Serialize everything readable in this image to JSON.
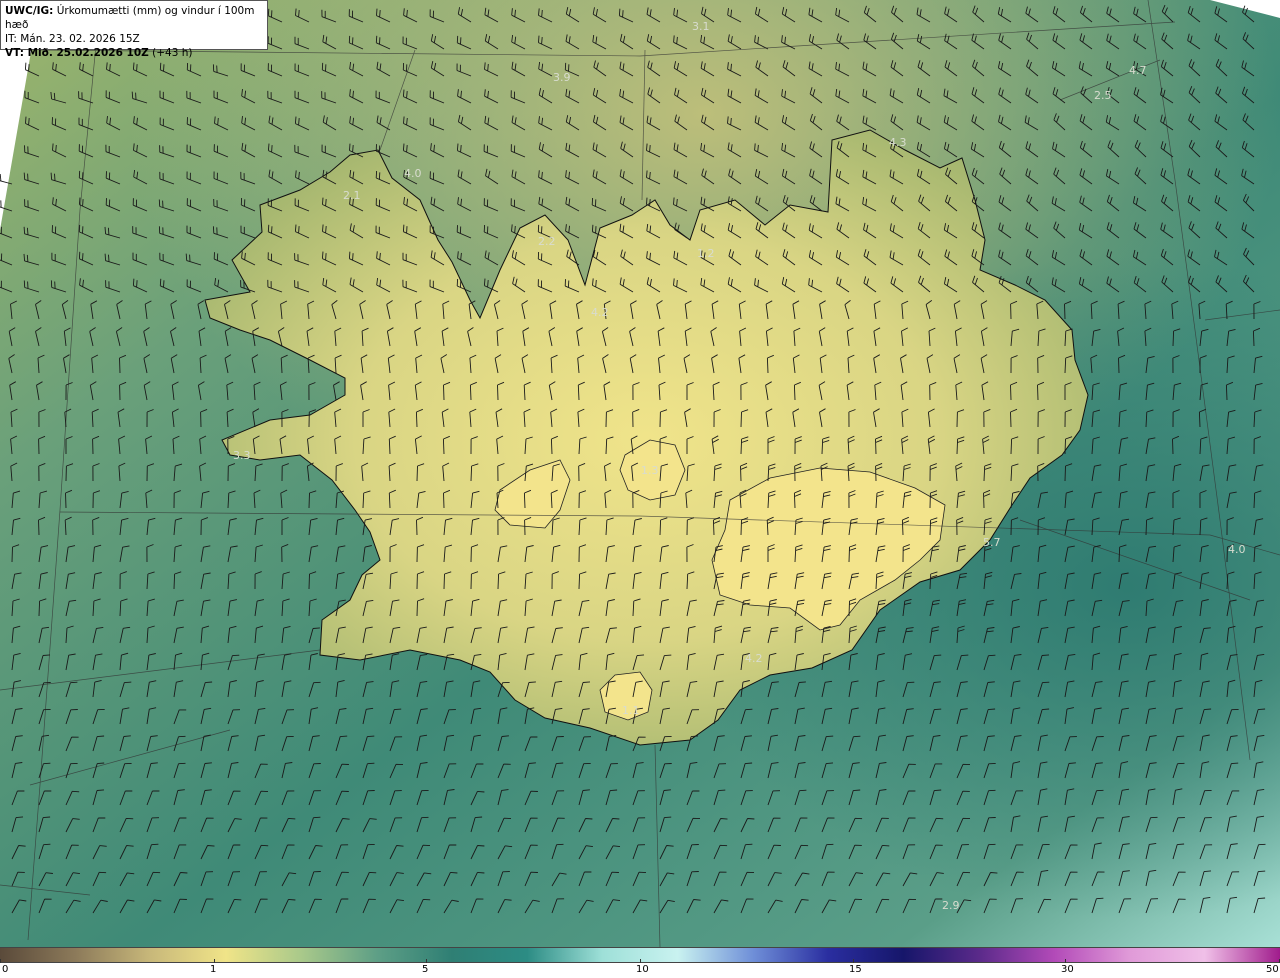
{
  "header": {
    "model": "UWC/IG:",
    "description": "Úrkomumætti (mm) og vindur í 100m hæð",
    "issue_time": "IT: Mán. 23. 02. 2026 15Z",
    "valid_prefix": "VT: Mið. 25.02.2026 10Z",
    "valid_lead": "(+43 h)"
  },
  "colorbar": {
    "ticks": [
      "0",
      "1",
      "5",
      "10",
      "15",
      "30",
      "50"
    ],
    "tick_positions": [
      0.0,
      0.167,
      0.333,
      0.5,
      0.667,
      0.833,
      1.0
    ],
    "colors": [
      "#5a4a3a",
      "#8c7a5a",
      "#c8b87a",
      "#f0e488",
      "#a9c98a",
      "#5e9f86",
      "#2f7f74",
      "#2c8c84",
      "#9ee0d8",
      "#c9f2f0",
      "#6f8fd8",
      "#2a2ea0",
      "#16166a",
      "#5a2a8a",
      "#b24ab8",
      "#e09ad8",
      "#f0c0e8",
      "#a01c8c"
    ]
  },
  "map_labels": [
    {
      "text": "3.1"
    },
    {
      "text": "3.9"
    },
    {
      "text": "4.7"
    },
    {
      "text": "2.5"
    },
    {
      "text": "4.3"
    },
    {
      "text": "4.0"
    },
    {
      "text": "2.1"
    },
    {
      "text": "2.2"
    },
    {
      "text": "4.2"
    },
    {
      "text": "1.2"
    },
    {
      "text": "3.3"
    },
    {
      "text": "1.3"
    },
    {
      "text": "5.7"
    },
    {
      "text": "4.0"
    },
    {
      "text": "4.2"
    },
    {
      "text": "1.1"
    },
    {
      "text": "2.9"
    }
  ],
  "palette": {
    "sea_deep": "#2f7d6e",
    "sea_mid": "#4e9383",
    "land_yellow": "#e7df8b",
    "land_olive": "#a9b36b",
    "coast": "#111111",
    "barb": "#1a1a1a"
  }
}
